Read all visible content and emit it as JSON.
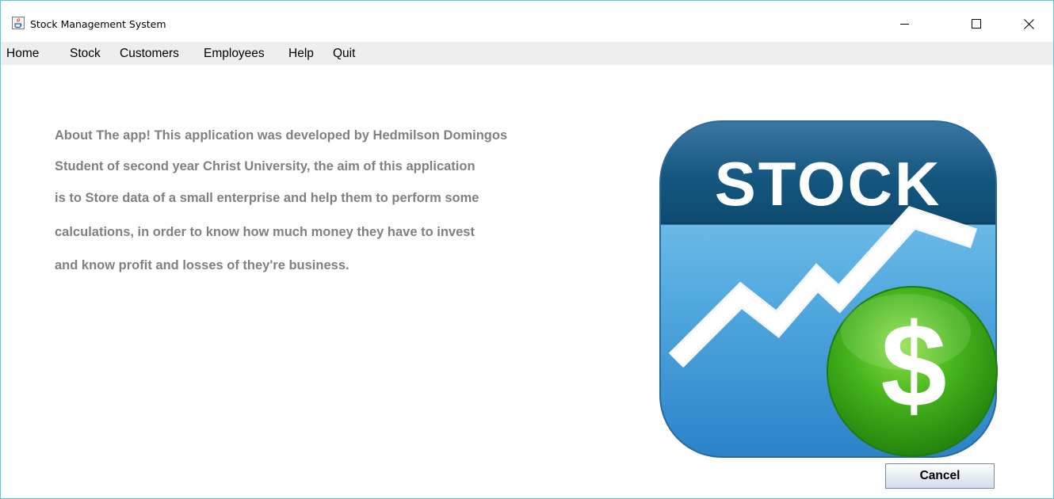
{
  "window": {
    "title": "Stock Management System",
    "icon": "java-coffee-cup-icon",
    "controls": {
      "minimize_icon": "minimize-icon",
      "maximize_icon": "maximize-icon",
      "close_icon": "close-icon"
    }
  },
  "menu": {
    "items": [
      "Home",
      "Stock",
      "Customers",
      "Employees",
      "Help",
      "Quit"
    ]
  },
  "about": {
    "lines": [
      "About The app! This application was developed by Hedmilson Domingos",
      "Student of second year Christ University, the aim of this application",
      "is to Store data of a small enterprise and help them to perform some",
      "calculations, in order to know how much money they have to invest",
      "and know profit and losses of they're business."
    ],
    "color": "#808080"
  },
  "logo": {
    "heading": "STOCK",
    "currency_symbol": "$",
    "icon": "stock-dollar-logo-icon",
    "colors": {
      "header_dark": "#0f4c75",
      "body_light": "#6ec1ea",
      "body_dark": "#2a86c9",
      "coin": "#3fb81b"
    }
  },
  "buttons": {
    "cancel_label": "Cancel"
  }
}
